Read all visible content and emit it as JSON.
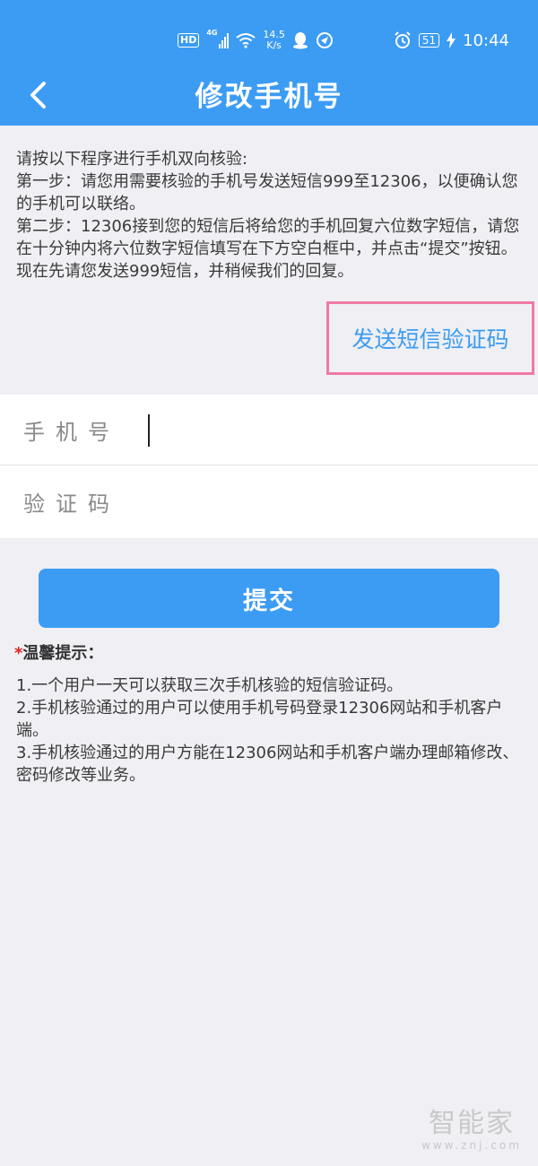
{
  "status_bar": {
    "hd": "HD",
    "network": "4G",
    "speed_value": "14.5",
    "speed_unit": "K/s",
    "battery": "51",
    "time": "10:44"
  },
  "header": {
    "title": "修改手机号",
    "back_icon": "chevron-left-icon"
  },
  "instructions": {
    "line1": "请按以下程序进行手机双向核验:",
    "line2": "第一步：请您用需要核验的手机号发送短信999至12306，以便确认您的手机可以联络。",
    "line3": "第二步：12306接到您的短信后将给您的手机回复六位数字短信，请您在十分钟内将六位数字短信填写在下方空白框中，并点击“提交”按钮。 现在先请您发送999短信，并稍候我们的回复。"
  },
  "send_code_label": "发送短信验证码",
  "form": {
    "phone_label": "手机号",
    "code_label": "验证码",
    "phone_value": "",
    "code_value": ""
  },
  "submit_label": "提交",
  "tips": {
    "star": "*",
    "title": "温馨提示：",
    "items": [
      "1.一个用户一天可以获取三次手机核验的短信验证码。",
      "2.手机核验通过的用户可以使用手机号码登录12306网站和手机客户端。",
      "3.手机核验通过的用户方能在12306网站和手机客户端办理邮箱修改、密码修改等业务。"
    ]
  },
  "watermark": {
    "main": "智能家",
    "sub": "www.znj.com"
  },
  "colors": {
    "primary": "#3c9cf3",
    "highlight_border": "#f07aa4",
    "background": "#efeff4",
    "required_star": "#e02020"
  }
}
